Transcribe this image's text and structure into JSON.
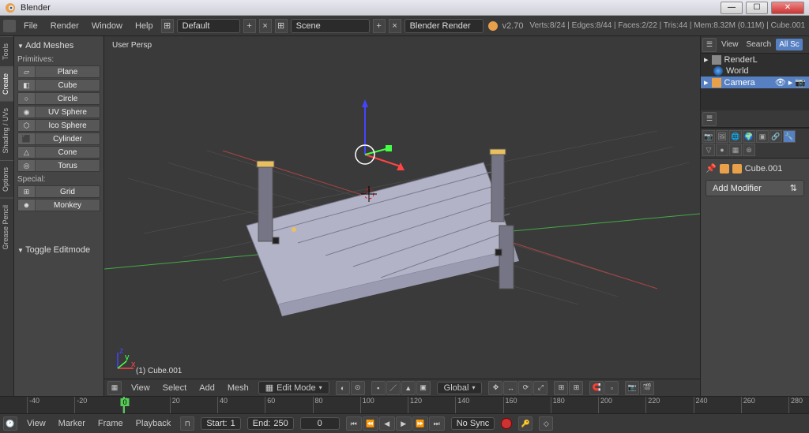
{
  "window": {
    "title": "Blender"
  },
  "menus": [
    "File",
    "Render",
    "Window",
    "Help"
  ],
  "layout_name": "Default",
  "scene_name": "Scene",
  "engine": "Blender Render",
  "version": "v2.70",
  "stats": "Verts:8/24 | Edges:8/44 | Faces:2/22 | Tris:44 | Mem:8.32M (0.11M) | Cube.001",
  "vtabs": [
    "Tools",
    "Create",
    "Shading / UVs",
    "Options",
    "Grease Pencil"
  ],
  "toolpanel": {
    "header": "Add Meshes",
    "primitives_label": "Primitives:",
    "primitives": [
      "Plane",
      "Cube",
      "Circle",
      "UV Sphere",
      "Ico Sphere",
      "Cylinder",
      "Cone",
      "Torus"
    ],
    "special_label": "Special:",
    "special": [
      "Grid",
      "Monkey"
    ],
    "toggle": "Toggle Editmode"
  },
  "viewport": {
    "persp_label": "User Persp",
    "object_label": "(1) Cube.001",
    "menus": [
      "View",
      "Select",
      "Add",
      "Mesh"
    ],
    "mode": "Edit Mode",
    "orientation": "Global"
  },
  "rightpanel": {
    "header_menus": [
      "View",
      "Search",
      "All Sc"
    ],
    "outliner": [
      {
        "label": "RenderL",
        "type": "scene"
      },
      {
        "label": "World",
        "type": "world"
      },
      {
        "label": "Camera",
        "type": "camera",
        "selected": true
      }
    ],
    "breadcrumb_obj": "Cube.001",
    "modifier_btn": "Add Modifier"
  },
  "timeline": {
    "ticks": [
      -40,
      -20,
      0,
      20,
      40,
      60,
      80,
      100,
      120,
      140,
      160,
      180,
      200,
      220,
      240,
      260,
      280
    ],
    "cursor": 0,
    "menus": [
      "View",
      "Marker",
      "Frame",
      "Playback"
    ],
    "start_label": "Start:",
    "start_val": "1",
    "end_label": "End:",
    "end_val": "250",
    "current_val": "0",
    "sync": "No Sync"
  }
}
